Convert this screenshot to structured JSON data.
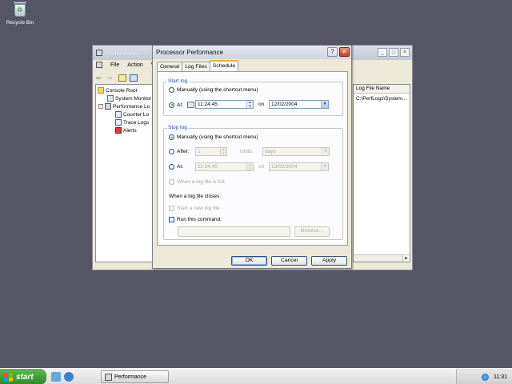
{
  "desktop": {
    "recycle_bin_label": "Recycle Bin"
  },
  "mmc": {
    "title": "Performance",
    "menu": [
      "File",
      "Action",
      "Vi"
    ],
    "tree": [
      {
        "label": "Console Root"
      },
      {
        "label": "System Monitor"
      },
      {
        "label": "Performance Lo"
      },
      {
        "label": "Counter Lo"
      },
      {
        "label": "Trace Logs"
      },
      {
        "label": "Alerts"
      }
    ],
    "list": {
      "header": "Log File Name",
      "rows": [
        "C:\\PerfLogs\\System..."
      ]
    }
  },
  "dialog": {
    "title": "Processor Performance",
    "tabs": [
      "General",
      "Log Files",
      "Schedule"
    ],
    "active_tab": "Schedule",
    "start_log": {
      "legend": "Start log",
      "manual_label": "Manually (using the shortcut menu)",
      "at_label": "At:",
      "time": "11:24:45",
      "on_label": "on",
      "date": "12/02/2004"
    },
    "stop_log": {
      "legend": "Stop log",
      "manual_label": "Manually (using the shortcut menu)",
      "after_label": "After:",
      "after_value": "1",
      "units_label": "Units:",
      "units_value": "days",
      "at_label": "At:",
      "time": "11:24:45",
      "on_label": "on",
      "date": "13/02/2004",
      "full_label": "When a log file is full.",
      "closes_label": "When a log file closes:",
      "start_new_label": "Start a new log file",
      "run_cmd_label": "Run this command:",
      "command_value": "",
      "browse_label": "Browse..."
    },
    "buttons": {
      "ok": "OK",
      "cancel": "Cancel",
      "apply": "Apply"
    }
  },
  "taskbar": {
    "start_label": "start",
    "task_label": "Performance",
    "lang": "EN",
    "clock": "11:31"
  }
}
